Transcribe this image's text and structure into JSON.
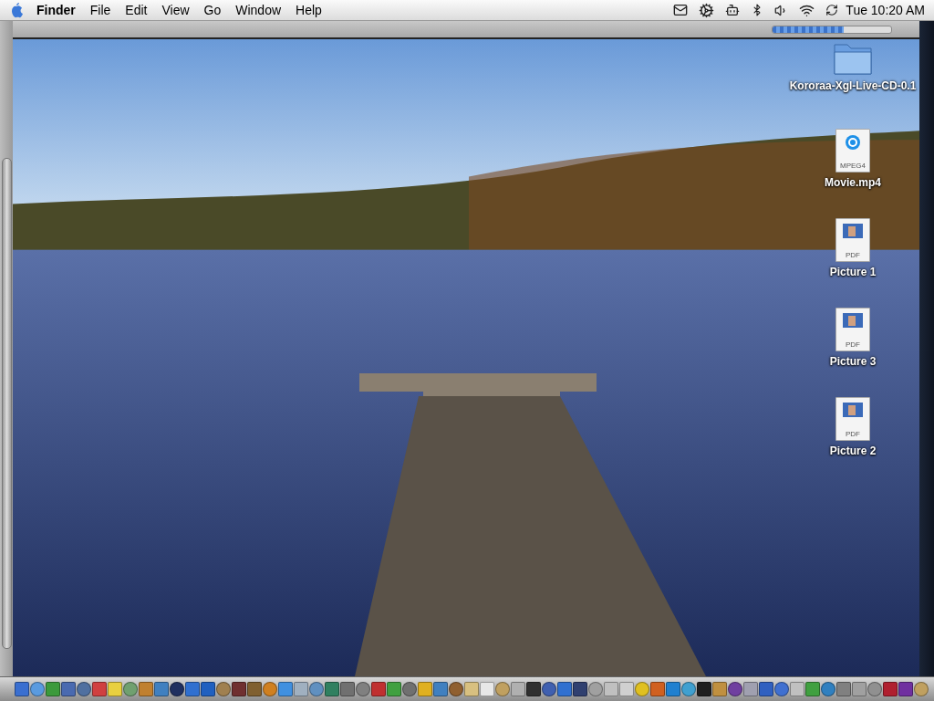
{
  "menubar": {
    "app_name": "Finder",
    "menus": [
      "File",
      "Edit",
      "View",
      "Go",
      "Window",
      "Help"
    ],
    "clock": "Tue 10:20 AM"
  },
  "progress": {
    "level": 0.6
  },
  "desktop_icons": [
    {
      "kind": "folder",
      "label": "Kororaa-Xgl-Live-CD-0.1"
    },
    {
      "kind": "movie",
      "label": "Movie.mp4",
      "badge": "MPEG4"
    },
    {
      "kind": "pdf",
      "label": "Picture 1",
      "badge": "PDF"
    },
    {
      "kind": "pdf",
      "label": "Picture 3",
      "badge": "PDF"
    },
    {
      "kind": "pdf",
      "label": "Picture 2",
      "badge": "PDF"
    }
  ]
}
